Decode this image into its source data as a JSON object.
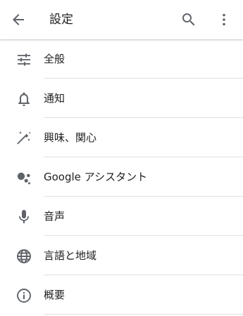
{
  "toolbar": {
    "title": "設定",
    "back_icon": "arrow-back-icon",
    "search_icon": "search-icon",
    "more_icon": "more-vert-icon"
  },
  "settings_items": [
    {
      "label": "全般",
      "icon": "tune-icon"
    },
    {
      "label": "通知",
      "icon": "bell-icon"
    },
    {
      "label": "興味、関心",
      "icon": "magic-wand-icon"
    },
    {
      "label": "Google アシスタント",
      "icon": "assistant-icon"
    },
    {
      "label": "音声",
      "icon": "mic-icon"
    },
    {
      "label": "言語と地域",
      "icon": "globe-icon"
    },
    {
      "label": "概要",
      "icon": "info-icon"
    }
  ],
  "colors": {
    "icon": "#5f6368",
    "text": "#212121",
    "divider": "#e0e0e0",
    "background": "#ffffff"
  }
}
